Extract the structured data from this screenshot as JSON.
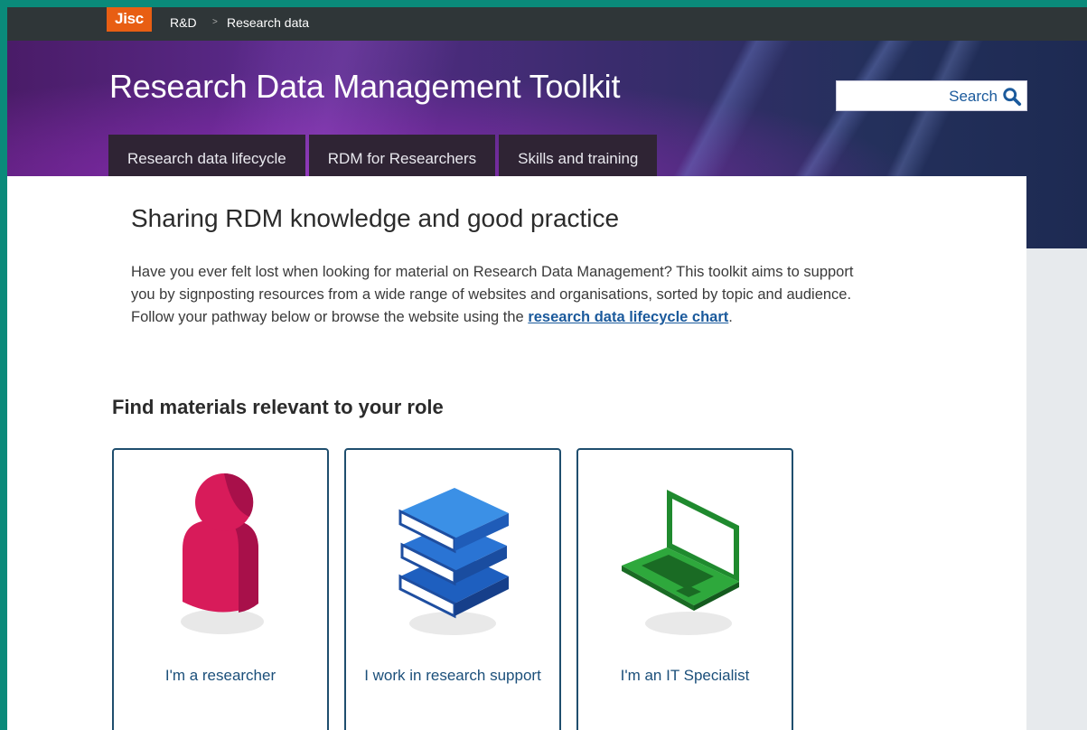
{
  "topbar": {
    "logo": "Jisc",
    "breadcrumb": [
      "R&D",
      "Research data"
    ],
    "separator": ">"
  },
  "header": {
    "site_title": "Research Data Management Toolkit",
    "search_label": "Search",
    "search_icon": "magnifier-icon",
    "nav_tabs": [
      "Research data lifecycle",
      "RDM for Researchers",
      "Skills and training"
    ]
  },
  "main": {
    "heading": "Sharing RDM knowledge and good practice",
    "intro_text": "Have you ever felt lost when looking for material on Research Data Management? This toolkit aims to support you by signposting resources from a wide range of websites and organisations, sorted by topic and audience. Follow your pathway below or browse the website using the ",
    "intro_link": "research data lifecycle chart",
    "intro_end": ".",
    "subheading": "Find materials relevant to your role",
    "roles": [
      {
        "label": "I'm a researcher",
        "icon": "researcher-person-icon"
      },
      {
        "label": "I work in research support",
        "icon": "books-stack-icon"
      },
      {
        "label": "I'm an IT Specialist",
        "icon": "laptop-icon"
      }
    ]
  },
  "colors": {
    "accent_orange": "#e85e13",
    "link_blue": "#1b5a9c",
    "teal_border": "#0a8a7a"
  }
}
